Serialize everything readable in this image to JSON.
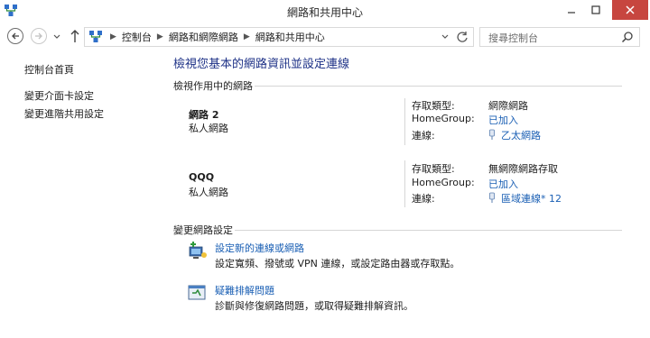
{
  "window": {
    "title": "網路和共用中心"
  },
  "address": {
    "crumbs": [
      "控制台",
      "網路和網際網路",
      "網路和共用中心"
    ],
    "search_placeholder": "搜尋控制台"
  },
  "left": {
    "home": "控制台首頁",
    "adapter": "變更介面卡設定",
    "sharing": "變更進階共用設定"
  },
  "main": {
    "title": "檢視您基本的網路資訊並設定連線",
    "active_header": "檢視作用中的網路",
    "change_header": "變更網路設定",
    "labels": {
      "access": "存取類型:",
      "homegroup": "HomeGroup:",
      "connections": "連線:"
    },
    "networks": [
      {
        "name": "網路 2",
        "type": "私人網路",
        "access": "網際網路",
        "homegroup": "已加入",
        "connection": "乙太網路"
      },
      {
        "name": "QQQ",
        "type": "私人網路",
        "access": "無網際網路存取",
        "homegroup": "已加入",
        "connection": "區域連線* 12"
      }
    ],
    "tasks": [
      {
        "link": "設定新的連線或網路",
        "desc": "設定寬頻、撥號或 VPN 連線，或設定路由器或存取點。"
      },
      {
        "link": "疑難排解問題",
        "desc": "診斷與修復網路問題，或取得疑難排解資訊。"
      }
    ]
  },
  "colors": {
    "link": "#1a5fb4",
    "title": "#1e3287",
    "close": "#c7463f"
  },
  "icons": [
    "network-app-icon",
    "minimize-icon",
    "maximize-icon",
    "close-icon",
    "back-arrow-icon",
    "forward-arrow-icon",
    "chevron-down-icon",
    "up-arrow-icon",
    "refresh-icon",
    "search-icon",
    "ethernet-icon",
    "new-connection-icon",
    "troubleshoot-icon"
  ]
}
